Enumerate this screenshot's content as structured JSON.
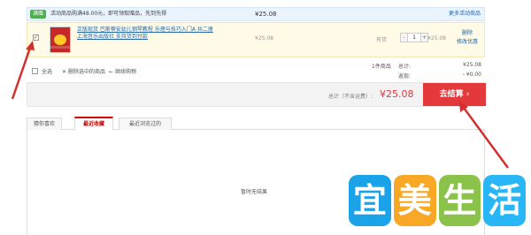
{
  "promo": {
    "badge": "满赠",
    "text": "活动商品购满48.00元，即可领取赠品，先到先得",
    "price": "¥25.08",
    "link": "更多活动商品"
  },
  "item": {
    "title": "正版现货 巴斯蒂安幼儿钢琴教程 乐理与技巧入门A 共二册 上海音乐出版社 支持货到付款",
    "price": "¥25.08",
    "stock": "有货",
    "qty_minus": "-",
    "quantity": "1",
    "qty_plus": "+",
    "subtotal": "¥25.08",
    "delete": "删除",
    "change_promo": "修改优惠"
  },
  "actions": {
    "select_all": "全选",
    "delete_selected": "删除选中的商品",
    "continue": "继续购物",
    "count": "1件商品",
    "total_label": "总计:",
    "total_value": "¥25.08",
    "return_label": "返现:",
    "return_value": "- ¥0.00"
  },
  "totalbar": {
    "label": "总计（不含运费）:",
    "value": "¥25.08",
    "checkout": "去结算 ›"
  },
  "tabs": [
    {
      "label": "猜你喜欢"
    },
    {
      "label": "最近收藏"
    },
    {
      "label": "最近浏览过的"
    }
  ],
  "panel": {
    "empty": "暂时无结果"
  },
  "watermark": {
    "chars": [
      "宜",
      "美",
      "生",
      "活"
    ],
    "colors": [
      "#1aa3e8",
      "#f9a825",
      "#8bc34a",
      "#29b6f6"
    ]
  },
  "colors": {
    "accent": "#e4393c",
    "link": "#2266aa",
    "annotation_arrow": "#d32f2f"
  }
}
